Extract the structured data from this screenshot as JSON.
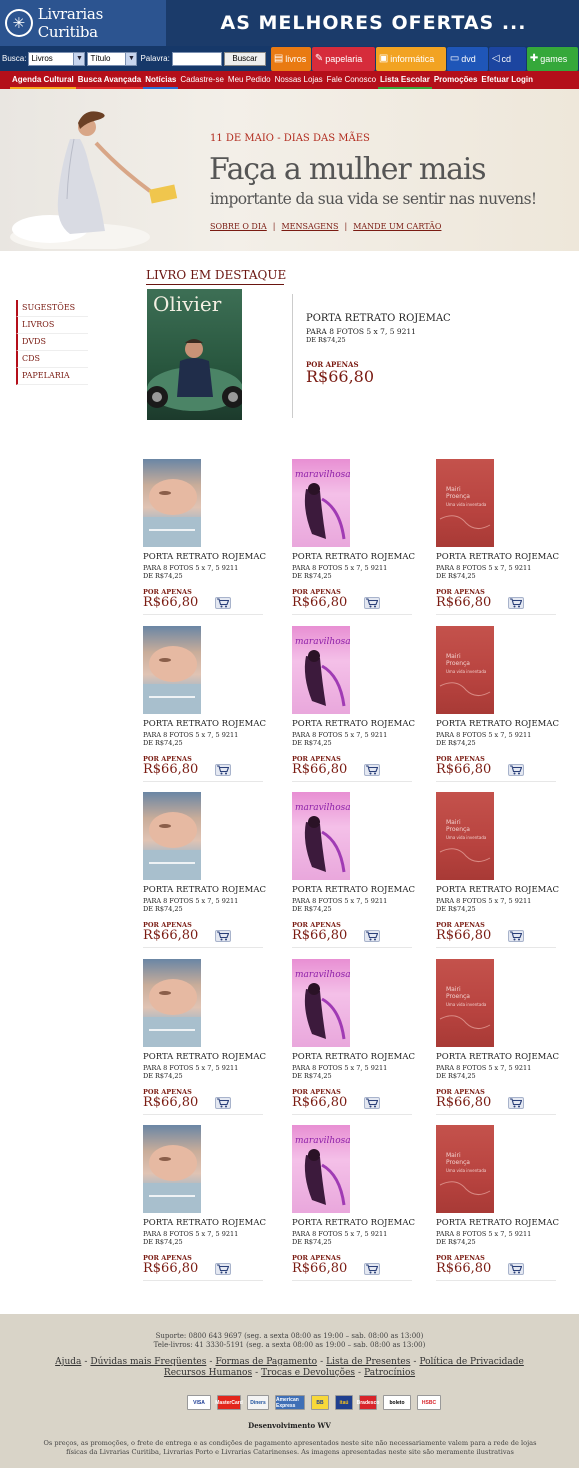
{
  "header": {
    "logo_text": "Livrarias Curitiba",
    "banner": "AS MELHORES OFERTAS ..."
  },
  "search": {
    "busca_label": "Busca:",
    "category_value": "Livros",
    "field_value": "Título",
    "palavra_label": "Palavra:",
    "button_label": "Buscar",
    "input_value": ""
  },
  "categories": [
    {
      "label": "livros",
      "icon": "book-icon",
      "color": "#e97a12"
    },
    {
      "label": "papelaria",
      "icon": "pencil-icon",
      "color": "#d62c3b"
    },
    {
      "label": "informática",
      "icon": "computer-icon",
      "color": "#f2a322"
    },
    {
      "label": "dvd",
      "icon": "monitor-icon",
      "color": "#1f56b8"
    },
    {
      "label": "cd",
      "icon": "speaker-icon",
      "color": "#1c45a0"
    },
    {
      "label": "games",
      "icon": "gamepad-icon",
      "color": "#35a83a"
    }
  ],
  "nav": [
    "Agenda Cultural",
    "Busca Avançada",
    "Notícias",
    "Cadastre-se",
    "Meu Pedido",
    "Nossas Lojas",
    "Fale Conosco",
    "Lista Escolar",
    "Promoções",
    "Efetuar Login"
  ],
  "hero": {
    "date_label": "11 DE MAIO - DIAS DAS MÃES",
    "title": "Faça a mulher mais",
    "subtitle": "importante da sua vida se sentir nas nuvens!",
    "links": [
      "SOBRE O DIA",
      "MENSAGENS",
      "MANDE UM CARTÃO"
    ]
  },
  "sidebar": [
    "SUGESTÕES",
    "LIVROS",
    "DVDS",
    "CDS",
    "PAPELARIA"
  ],
  "featured": {
    "heading": "LIVRO EM DESTAQUE",
    "cover_title": "Olivier",
    "name": "PORTA RETRATO ROJEMAC",
    "desc": "PARA 8 FOTOS 5 x 7, 5 9211",
    "old_price": "DE R$74,25",
    "por_apenas": "POR APENAS",
    "price": "R$66,80"
  },
  "product": {
    "name": "PORTA RETRATO ROJEMAC",
    "desc": "PARA 8 FOTOS 5 x 7, 5 9211",
    "old_price": "DE R$74,25",
    "por_apenas": "POR APENAS",
    "price": "R$66,80"
  },
  "footer": {
    "suporte": "Suporte: 0800 643 9697 (seg. a sexta 08:00 as 19:00 – sab. 08:00 as 13:00)",
    "tele": "Tele-livros: 41 3330-5191 (seg. a sexta 08:00 as 19:00 – sab. 08:00 as 13:00)",
    "links1": [
      "Ajuda",
      "Dúvidas mais Freqüentes",
      "Formas de Pagamento",
      "Lista de Presentes",
      "Política de Privacidade"
    ],
    "links2": [
      "Recursos Humanos",
      "Trocas e Devoluções",
      "Patrocínios"
    ],
    "cards": [
      "VISA",
      "MasterCard",
      "Diners",
      "American Express",
      "BB",
      "itaú",
      "Bradesco",
      "boleto",
      "HSBC"
    ],
    "dev": "Desenvolvimento WV",
    "disclaimer": "Os preços, as promoções, o frete de entrega e as condições de pagamento apresentados neste site não necessariamente valem para a rede de lojas físicas da Livrarias Curitiba, Livrarias Porto e Livrarias Catarinenses. As imagens apresentadas neste site são meramente ilustrativas"
  },
  "colors": {
    "brand_blue": "#1b3b6a",
    "nav_red": "#b40f1a",
    "price_red": "#7a1b12",
    "footer_bg": "#d9d4c8"
  }
}
